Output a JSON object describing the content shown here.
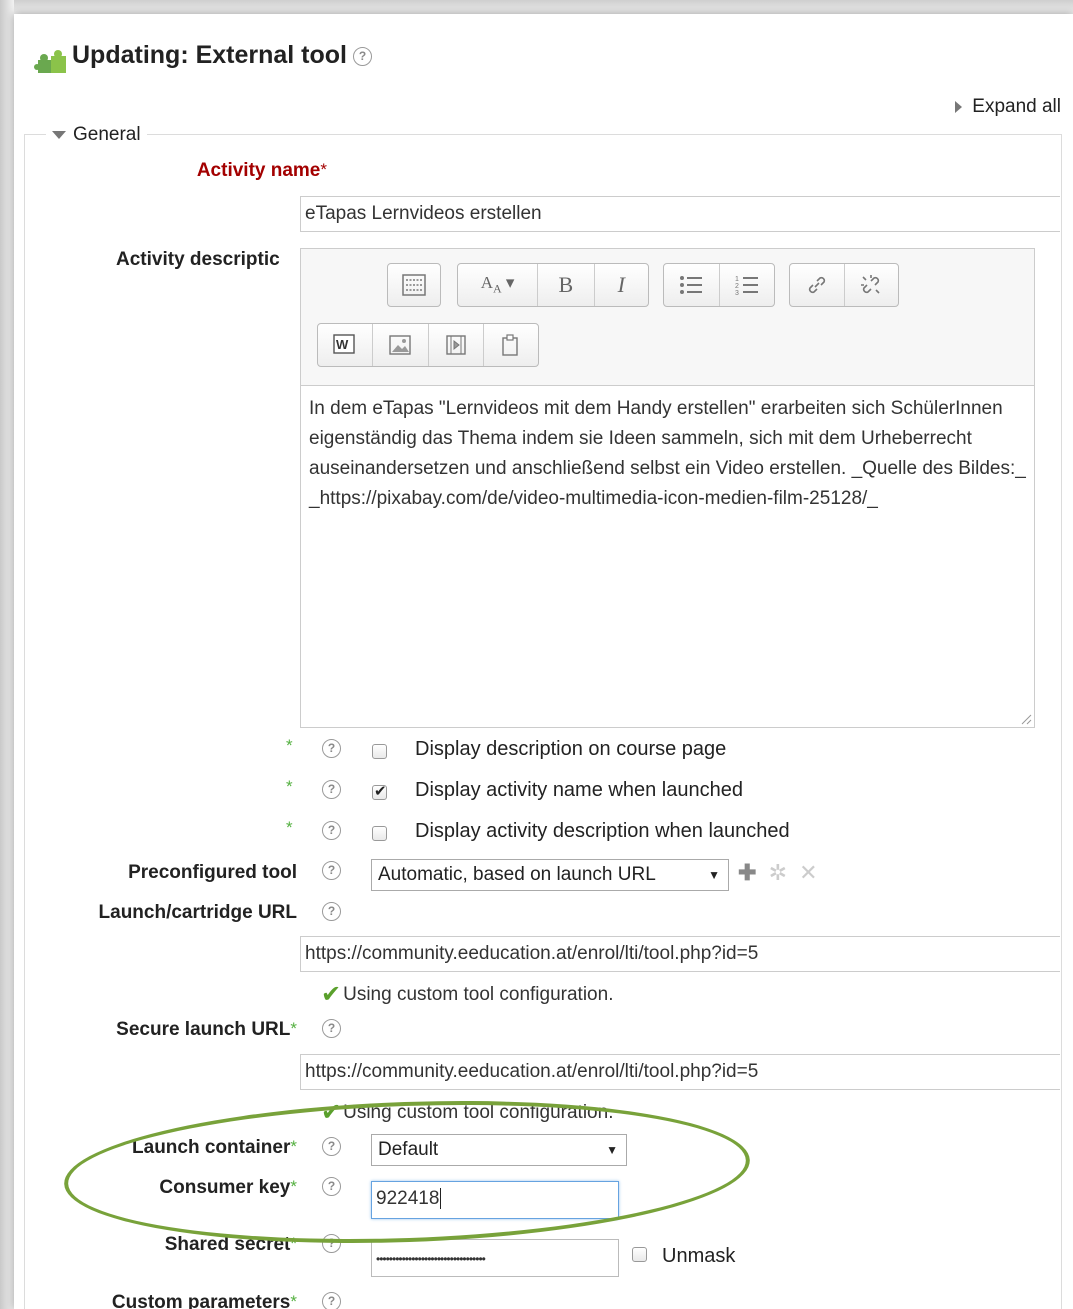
{
  "page": {
    "title": "Updating: External tool",
    "expand_all": "Expand all"
  },
  "general": {
    "legend": "General",
    "activity_name": {
      "label": "Activity name",
      "value": "eTapas Lernvideos erstellen"
    },
    "activity_description": {
      "label": "Activity descriptic",
      "text": "In dem eTapas \"Lernvideos mit dem Handy erstellen\" erarbeiten sich SchülerInnen eigenständig das Thema indem sie Ideen sammeln, sich mit dem Urheberrecht auseinandersetzen und anschließend selbst ein Video erstellen. _Quelle des Bildes:_ _https://pixabay.com/de/video-multimedia-icon-medien-film-25128/_"
    },
    "checkboxes": [
      {
        "label": "Display description on course page",
        "checked": false
      },
      {
        "label": "Display activity name when launched",
        "checked": true
      },
      {
        "label": "Display activity description when launched",
        "checked": false
      }
    ],
    "preconfigured_tool": {
      "label": "Preconfigured tool",
      "value": "Automatic, based on launch URL"
    },
    "launch_url": {
      "label": "Launch/cartridge URL",
      "value": "https://community.eeducation.at/enrol/lti/tool.php?id=5",
      "note": "Using custom tool configuration."
    },
    "secure_launch_url": {
      "label": "Secure launch URL",
      "value": "https://community.eeducation.at/enrol/lti/tool.php?id=5",
      "note": "Using custom tool configuration."
    },
    "launch_container": {
      "label": "Launch container",
      "value": "Default"
    },
    "consumer_key": {
      "label": "Consumer key",
      "value": "922418"
    },
    "shared_secret": {
      "label": "Shared secret",
      "value": "••••••••••••••••••••••••••••••••••",
      "unmask": "Unmask"
    },
    "custom_parameters": {
      "label": "Custom parameters"
    }
  },
  "icons": {
    "help": "?",
    "required_star": "*",
    "check": "✔",
    "select_arrow": "▼",
    "plus": "✚",
    "gear": "✲",
    "remove": "✕"
  },
  "colors": {
    "required_label": "#a30000",
    "required_star": "#54b040",
    "highlight_oval": "#78a23a",
    "focus_border": "#66a3e0"
  }
}
